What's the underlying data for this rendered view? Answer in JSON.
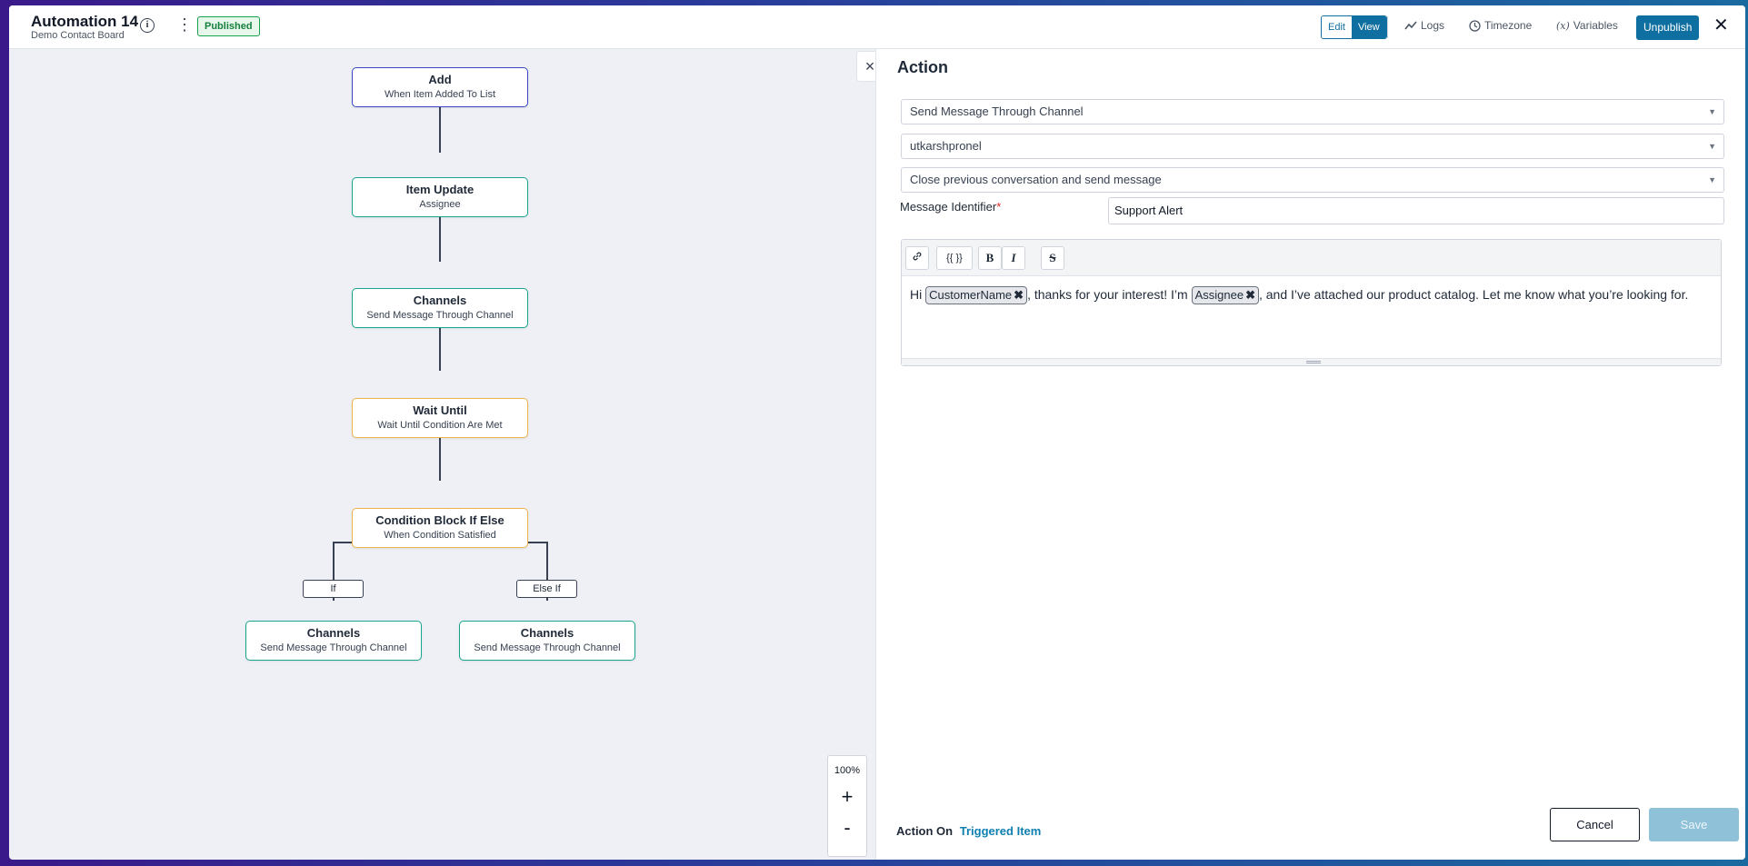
{
  "header": {
    "title": "Automation 14",
    "subtitle": "Demo Contact Board",
    "status": "Published",
    "mode_edit": "Edit",
    "mode_view": "View",
    "logs": "Logs",
    "timezone": "Timezone",
    "variables": "Variables",
    "unpublish": "Unpublish"
  },
  "flow": {
    "nodes": [
      {
        "title": "Add",
        "subtitle": "When Item Added To List"
      },
      {
        "title": "Item Update",
        "subtitle": "Assignee"
      },
      {
        "title": "Channels",
        "subtitle": "Send Message Through Channel"
      },
      {
        "title": "Wait Until",
        "subtitle": "Wait Until Condition Are Met"
      },
      {
        "title": "Condition Block If Else",
        "subtitle": "When Condition Satisfied"
      },
      {
        "title": "Channels",
        "subtitle": "Send Message Through Channel"
      },
      {
        "title": "Channels",
        "subtitle": "Send Message Through Channel"
      }
    ],
    "branch_if": "If",
    "branch_else": "Else If",
    "zoom": "100%",
    "zoom_in": "+",
    "zoom_out": "-"
  },
  "panel": {
    "title": "Action",
    "action_type": "Send Message Through Channel",
    "channel": "utkarshpronel",
    "conversation_mode": "Close previous conversation and send message",
    "identifier_label": "Message Identifier",
    "identifier_required": "*",
    "identifier_value": "Support Alert",
    "toolbar": {
      "link": "⊘",
      "variable": "{{ }}",
      "bold": "B",
      "italic": "I",
      "strike": "S"
    },
    "message": {
      "part1": "Hi",
      "chip1": "CustomerName",
      "part2": ", thanks for your interest! I’m",
      "chip2": "Assignee",
      "part3": ", and I’ve attached our product catalog. Let me know what you’re looking for."
    },
    "action_on_label": "Action On",
    "action_on_value": "Triggered Item",
    "cancel": "Cancel",
    "save": "Save"
  },
  "colors": {
    "accent": "#0f6fa0",
    "published": "#16a34a",
    "node_trigger": "#3b46c4",
    "node_action": "#17a58f",
    "node_condition": "#f0b34a"
  }
}
